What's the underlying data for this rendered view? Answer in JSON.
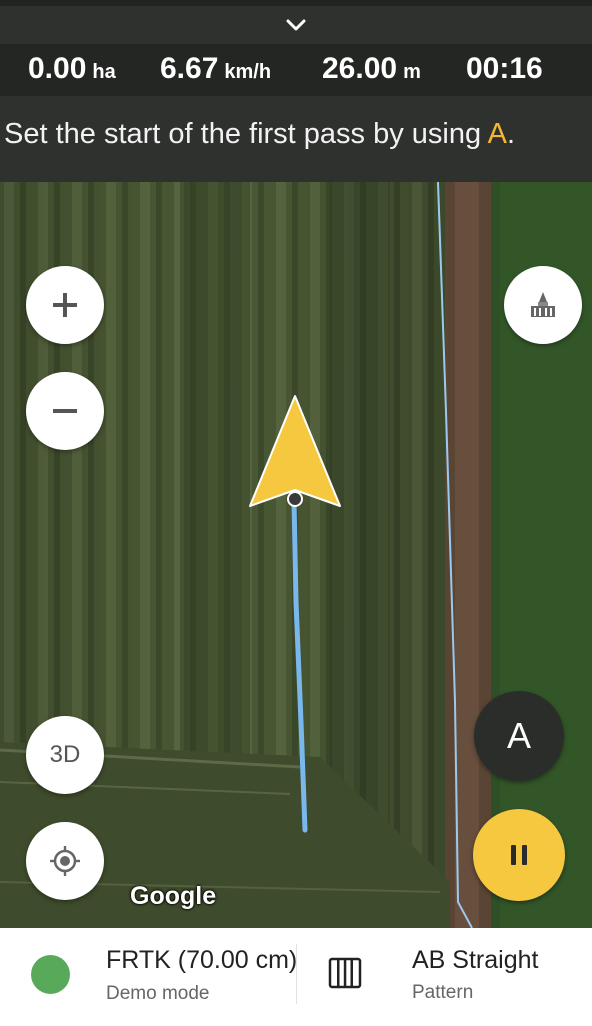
{
  "status": {
    "area": {
      "value": "0.00",
      "unit": "ha"
    },
    "speed": {
      "value": "6.67",
      "unit": "km/h"
    },
    "width": {
      "value": "26.00",
      "unit": "m"
    },
    "time": {
      "value": "00:16"
    }
  },
  "instruction": {
    "text": "Set the start of the first pass by using ",
    "highlight": "A",
    "suffix": "."
  },
  "map": {
    "a_button_label": "A",
    "three_d_label": "3D",
    "attribution": "Google"
  },
  "gps": {
    "title": "FRTK (70.00 cm)",
    "subtitle": "Demo mode",
    "status_color": "#59a95b"
  },
  "pattern": {
    "title": "AB Straight",
    "subtitle": "Pattern"
  },
  "colors": {
    "accent": "#f5c840",
    "highlight_text": "#f5b731",
    "track_line": "#7ab8ec"
  },
  "icons": [
    "chevron-down-icon",
    "zoom-in-icon",
    "zoom-out-icon",
    "field-tool-icon",
    "gps-locate-icon",
    "pause-icon",
    "pattern-icon",
    "vehicle-arrow-icon"
  ]
}
